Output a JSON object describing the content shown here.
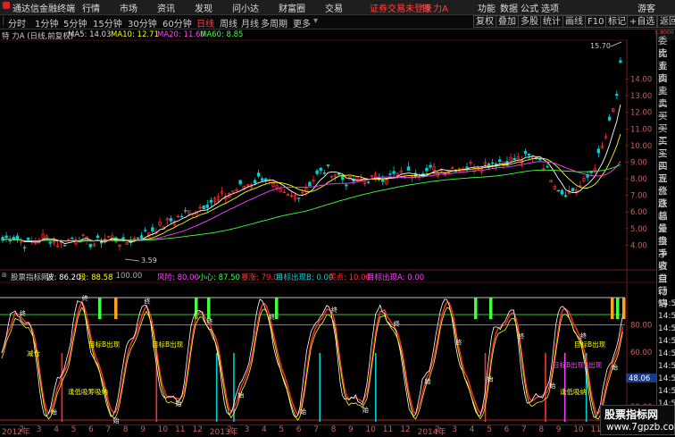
{
  "menubar": {
    "app_title": "通达信金融终端",
    "menus": [
      "行情",
      "市场",
      "资讯",
      "发现",
      "问小达",
      "财富圈",
      "交易"
    ],
    "warning": "证券交易未登录",
    "stock": "特 力A",
    "right": [
      "功能",
      "数据",
      "公式",
      "选项",
      "游客"
    ]
  },
  "toolbar": {
    "periods": [
      "分时",
      "1分钟",
      "5分钟",
      "15分钟",
      "30分钟",
      "60分钟",
      "日线",
      "周线",
      "月线",
      "多周期",
      "更多"
    ],
    "active": "日线",
    "buttons": [
      "复权",
      "叠加",
      "多股",
      "统计",
      "画线",
      "F10",
      "标记",
      "+自选",
      "返回"
    ]
  },
  "price_legend": {
    "name": "特 力A (日线,前复权)",
    "ma5": "MA5: 14.03",
    "ma10": "MA10: 12.71",
    "ma20": "MA20: 11.60",
    "ma60": "MA60: 8.85"
  },
  "price_axis": {
    "labels": [
      "14.00",
      "13.00",
      "12.00",
      "11.00",
      "10.00",
      "9.00",
      "8.00",
      "7.00",
      "6.00",
      "5.00",
      "4.00"
    ],
    "high_label": "15.70",
    "low_label": "3.59"
  },
  "indicator_legend": {
    "name": "股票指标网",
    "bo": "波: 86.20",
    "duan": "段: 88.58",
    "line100": ": 100.00",
    "fengxian": "风险: 80.00",
    "xiaoxin": "小心: 87.50",
    "baozhang": "暴涨: 79.06",
    "mubiao_b": "目标出现B: 0.00",
    "maidian": "买点: 10.00",
    "mubiao_a": "目标出现A: 0.00"
  },
  "indicator_axis": {
    "labels": [
      "80.00",
      "60.00",
      "40.00",
      "20.00"
    ],
    "current": "48.06"
  },
  "indicator_text": {
    "jian_cang": "减仓",
    "mubiao_b": "目标B出现",
    "mubiao_b2": "目标B出现",
    "feng_di": "逢低吸筹吸纳",
    "mubiao_b3": "目标B出现",
    "mubiao_big": "目标B出现B出现",
    "feng_di2": "逢低吸纳",
    "zhong": "终",
    "shi": "始"
  },
  "dates": [
    "2012年",
    "2",
    "3",
    "4",
    "5",
    "6",
    "7",
    "8",
    "9",
    "10",
    "11",
    "12",
    "2013年",
    "2",
    "3",
    "4",
    "5",
    "6",
    "7",
    "8",
    "9",
    "10",
    "11",
    "12",
    "2014年",
    "2",
    "3",
    "4",
    "5",
    "6",
    "7",
    "8",
    "9",
    "10",
    "11",
    "12"
  ],
  "sidebar": [
    "委比",
    "卖五",
    "卖四",
    "卖三",
    "卖二",
    "卖一",
    "买一",
    "买二",
    "买三",
    "买四",
    "买五",
    "现价",
    "涨跌",
    "涨幅",
    "总量",
    "外盘",
    "换手",
    "净资",
    "收益",
    "自动",
    "行情",
    "14:5",
    "14:5",
    "14:5",
    "14:5",
    "14:5",
    "14:5",
    "14:5",
    "14:5",
    "14:5",
    "14:5",
    "14:5"
  ],
  "corner": "L 8000",
  "watermark": {
    "line1": "股票指标网",
    "line2": "www.7gpzb.com"
  },
  "colors": {
    "up": "#ff3030",
    "down": "#00d0d0",
    "ma5": "#ffffff",
    "ma10": "#ffff00",
    "ma20": "#ff40ff",
    "ma60": "#40ff40",
    "bg": "#000000"
  }
}
